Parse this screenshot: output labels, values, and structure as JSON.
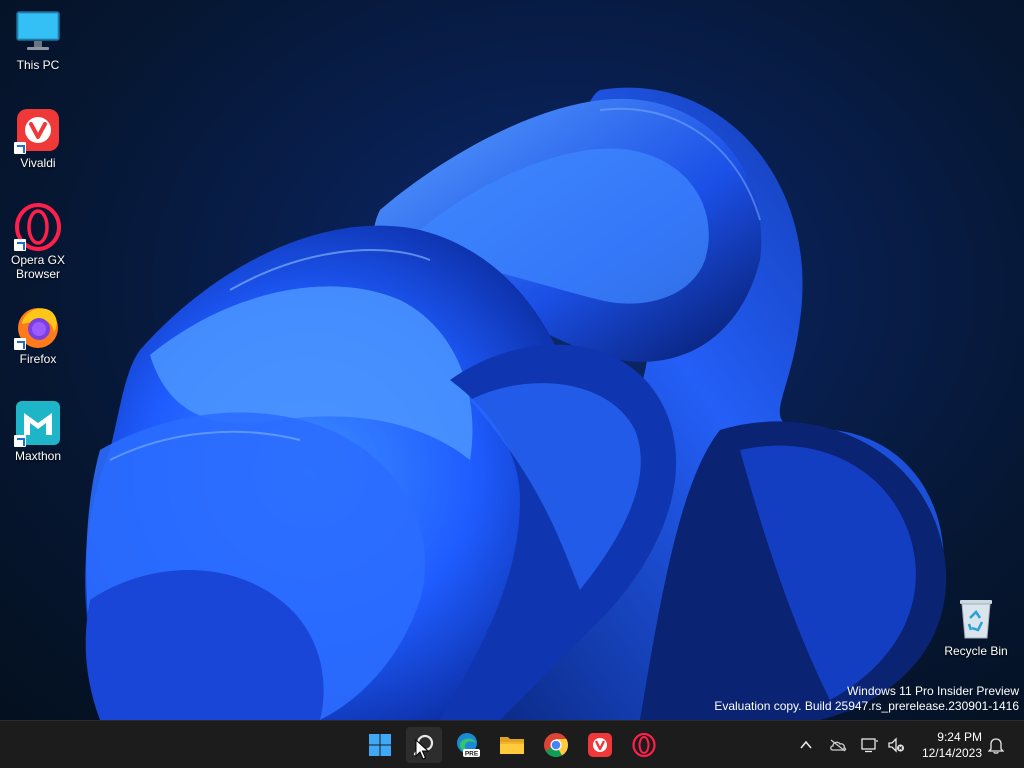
{
  "desktop": {
    "icons": [
      {
        "label": "This PC",
        "icon": "monitor-icon"
      },
      {
        "label": "Vivaldi",
        "icon": "vivaldi-icon"
      },
      {
        "label": "Opera GX Browser",
        "icon": "opera-gx-icon"
      },
      {
        "label": "Firefox",
        "icon": "firefox-icon"
      },
      {
        "label": "Maxthon",
        "icon": "maxthon-icon"
      }
    ],
    "recycle_bin": {
      "label": "Recycle Bin",
      "icon": "recycle-bin-icon"
    },
    "watermark": {
      "line1": "Windows 11 Pro Insider Preview",
      "line2": "Evaluation copy. Build 25947.rs_prerelease.230901-1416"
    },
    "colors": {
      "wallpaper_dark": "#061733",
      "bloom_blue": "#1f5cff"
    }
  },
  "taskbar": {
    "apps": [
      {
        "name": "Start",
        "icon": "windows-start-icon"
      },
      {
        "name": "Search",
        "icon": "search-icon"
      },
      {
        "name": "Microsoft Edge Preview",
        "icon": "edge-pre-icon",
        "badge": "PRE"
      },
      {
        "name": "File Explorer",
        "icon": "folder-icon"
      },
      {
        "name": "Google Chrome",
        "icon": "chrome-icon"
      },
      {
        "name": "Vivaldi",
        "icon": "vivaldi-icon"
      },
      {
        "name": "Opera GX",
        "icon": "opera-gx-icon"
      }
    ],
    "tray": {
      "icons": [
        "chevron-up-icon",
        "onedrive-offline-icon",
        "network-icon",
        "volume-muted-icon"
      ],
      "time": "9:24 PM",
      "date": "12/14/2023",
      "notification_icon": "bell-icon"
    },
    "colors": {
      "background": "#1c1c1c"
    }
  }
}
